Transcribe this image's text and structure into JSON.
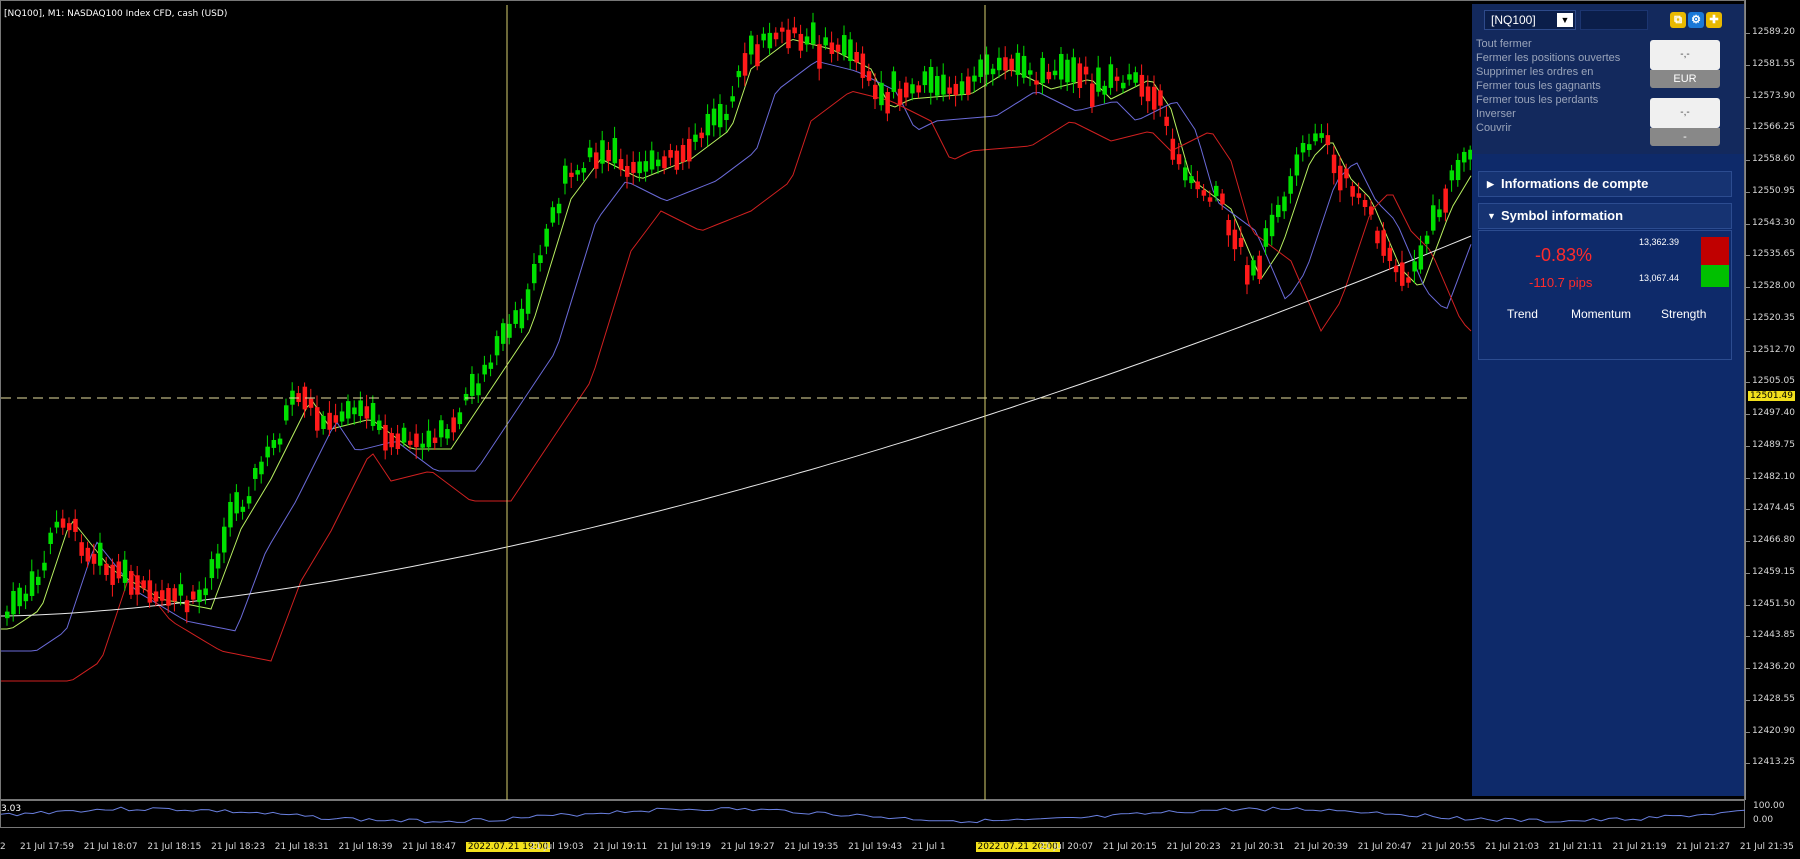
{
  "chart_title": "[NQ100], M1:  NASDAQ100 Index CFD, cash (USD)",
  "price_axis": [
    "12589.20",
    "12581.55",
    "12573.90",
    "12566.25",
    "12558.60",
    "12550.95",
    "12543.30",
    "12535.65",
    "12528.00",
    "12520.35",
    "12512.70",
    "12505.05",
    "12497.40",
    "12489.75",
    "12482.10",
    "12474.45",
    "12466.80",
    "12459.15",
    "12451.50",
    "12443.85",
    "12436.20",
    "12428.55",
    "12420.90",
    "12413.25"
  ],
  "current_price": "12501.49",
  "oscillator": {
    "label": "3.03",
    "axis_top": "100.00",
    "axis_bottom": "0.00"
  },
  "time_axis": [
    "21 Jul 17:59",
    "21 Jul 18:07",
    "21 Jul 18:15",
    "21 Jul 18:23",
    "21 Jul 18:31",
    "21 Jul 18:39",
    "21 Jul 18:47",
    "2022.07.21 19:00",
    "21 Jul 19:03",
    "21 Jul 19:11",
    "21 Jul 19:19",
    "21 Jul 19:27",
    "21 Jul 19:35",
    "21 Jul 19:43",
    "21 Jul 1",
    "2022.07.21 20:00",
    "21 Jul 20:07",
    "21 Jul 20:15",
    "21 Jul 20:23",
    "21 Jul 20:31",
    "21 Jul 20:39",
    "21 Jul 20:47",
    "21 Jul 20:55",
    "21 Jul 21:03",
    "21 Jul 21:11",
    "21 Jul 21:19",
    "21 Jul 21:27",
    "21 Jul 21:35"
  ],
  "time_axis_left_fragment": "2",
  "panel": {
    "symbol": "[NQ100]",
    "symbol_dropdown_glyph": "▼",
    "actions": [
      "Tout fermer",
      "Fermer les positions ouvertes",
      "Supprimer les ordres en",
      "Fermer tous les gagnants",
      "Fermer tous les perdants",
      "Inverser",
      "Couvrir"
    ],
    "button1_label": "-,-",
    "button1_sub": "EUR",
    "button2_label": "-,-",
    "button2_sub": "-",
    "sections": {
      "account": "Informations de compte",
      "symbol": "Symbol information"
    },
    "change_percent": "-0.83%",
    "change_pips": "-110.7 pips",
    "high": "13,362.39",
    "low": "13,067.44",
    "metrics": [
      "Trend",
      "Momentum",
      "Strength"
    ]
  },
  "colors": {
    "bull_candle": "#00e000",
    "bear_candle": "#ff1a1a",
    "ma_fast": "#b8f060",
    "ma_mid": "#6a6ad8",
    "ma_slow": "#d02020",
    "ma_long": "#e8e8e8",
    "crosshair": "#e8e0a0",
    "panel_bg": "#0e2a6a"
  }
}
